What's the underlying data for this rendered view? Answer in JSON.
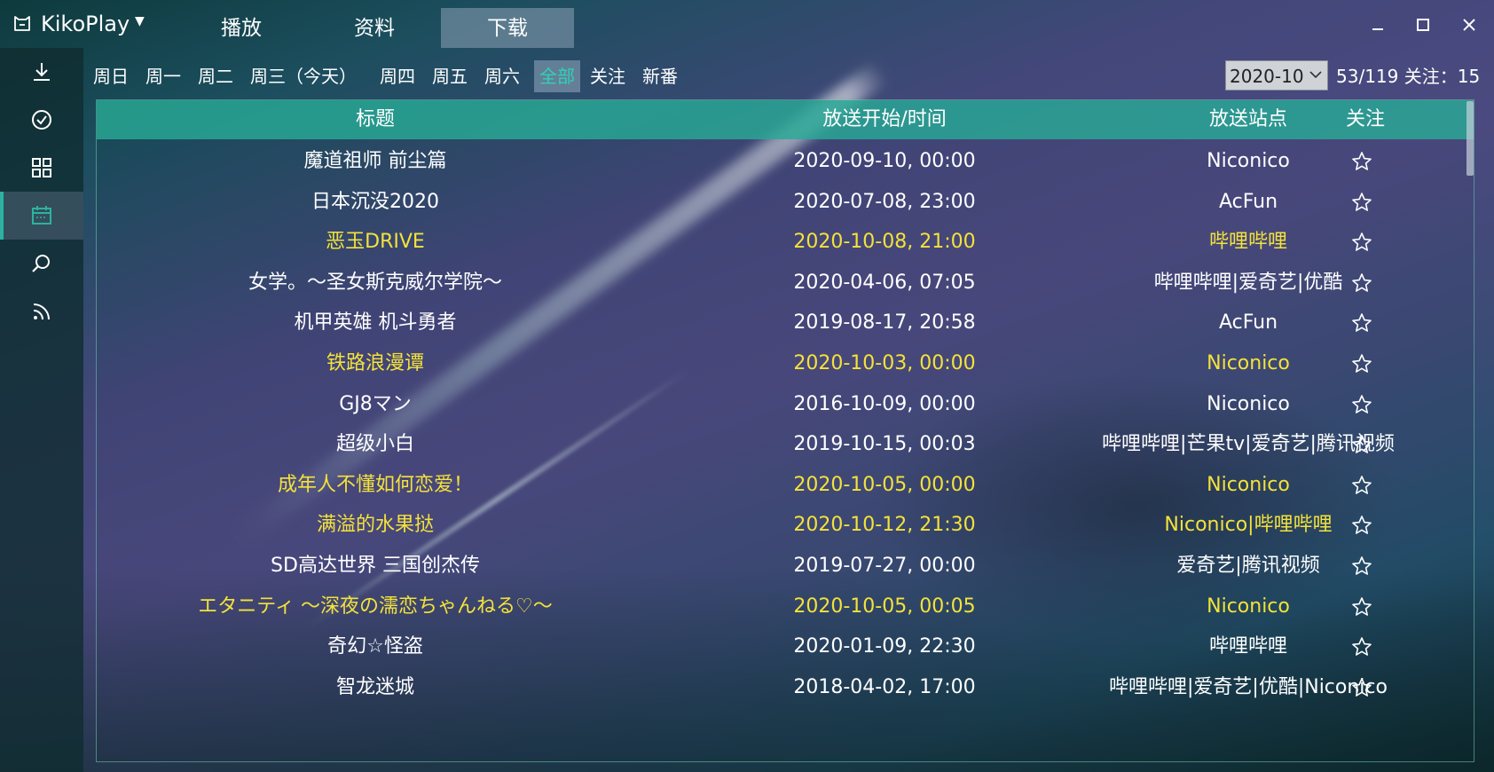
{
  "app": {
    "title": "KikoPlay"
  },
  "nav_tabs": [
    {
      "label": "播放",
      "active": false
    },
    {
      "label": "资料",
      "active": false
    },
    {
      "label": "下载",
      "active": true
    }
  ],
  "sidebar": {
    "items": [
      {
        "icon": "download-icon",
        "active": false
      },
      {
        "icon": "check-circle-icon",
        "active": false
      },
      {
        "icon": "grid-icon",
        "active": false
      },
      {
        "icon": "calendar-icon",
        "active": true
      },
      {
        "icon": "search-icon",
        "active": false
      },
      {
        "icon": "rss-icon",
        "active": false
      }
    ]
  },
  "filters": {
    "days": [
      "周日",
      "周一",
      "周二",
      "周三（今天）",
      "周四",
      "周五",
      "周六",
      "全部",
      "关注",
      "新番"
    ],
    "active": "全部"
  },
  "month_select": {
    "value": "2020-10"
  },
  "count_text": "53/119  关注：15",
  "table": {
    "headers": [
      "标题",
      "放送开始/时间",
      "放送站点",
      "关注"
    ],
    "rows": [
      {
        "title": "魔道祖师 前尘篇",
        "time": "2020-09-10, 00:00",
        "site": "Niconico",
        "highlight": false
      },
      {
        "title": "日本沉没2020",
        "time": "2020-07-08, 23:00",
        "site": "AcFun",
        "highlight": false
      },
      {
        "title": "恶玉DRIVE",
        "time": "2020-10-08, 21:00",
        "site": "哔哩哔哩",
        "highlight": true
      },
      {
        "title": "女学。～圣女斯克威尔学院～",
        "time": "2020-04-06, 07:05",
        "site": "哔哩哔哩|爱奇艺|优酷",
        "highlight": false
      },
      {
        "title": "机甲英雄 机斗勇者",
        "time": "2019-08-17, 20:58",
        "site": "AcFun",
        "highlight": false
      },
      {
        "title": "铁路浪漫谭",
        "time": "2020-10-03, 00:00",
        "site": "Niconico",
        "highlight": true
      },
      {
        "title": "GJ8マン",
        "time": "2016-10-09, 00:00",
        "site": "Niconico",
        "highlight": false
      },
      {
        "title": "超级小白",
        "time": "2019-10-15, 00:03",
        "site": "哔哩哔哩|芒果tv|爱奇艺|腾讯视频",
        "highlight": false
      },
      {
        "title": "成年人不懂如何恋爱！",
        "time": "2020-10-05, 00:00",
        "site": "Niconico",
        "highlight": true
      },
      {
        "title": "满溢的水果挞",
        "time": "2020-10-12, 21:30",
        "site": "Niconico|哔哩哔哩",
        "highlight": true
      },
      {
        "title": "SD高达世界 三国创杰传",
        "time": "2019-07-27, 00:00",
        "site": "爱奇艺|腾讯视频",
        "highlight": false
      },
      {
        "title": "エタニティ ～深夜の濡恋ちゃんねる♡～",
        "time": "2020-10-05, 00:05",
        "site": "Niconico",
        "highlight": true
      },
      {
        "title": "奇幻☆怪盗",
        "time": "2020-01-09, 22:30",
        "site": "哔哩哔哩",
        "highlight": false
      },
      {
        "title": "智龙迷城",
        "time": "2018-04-02, 17:00",
        "site": "哔哩哔哩|爱奇艺|优酷|Niconico",
        "highlight": false
      }
    ]
  },
  "colors": {
    "accent": "#2bb3a0",
    "highlight": "#f4e23a",
    "header_bg": "#28aa96"
  }
}
